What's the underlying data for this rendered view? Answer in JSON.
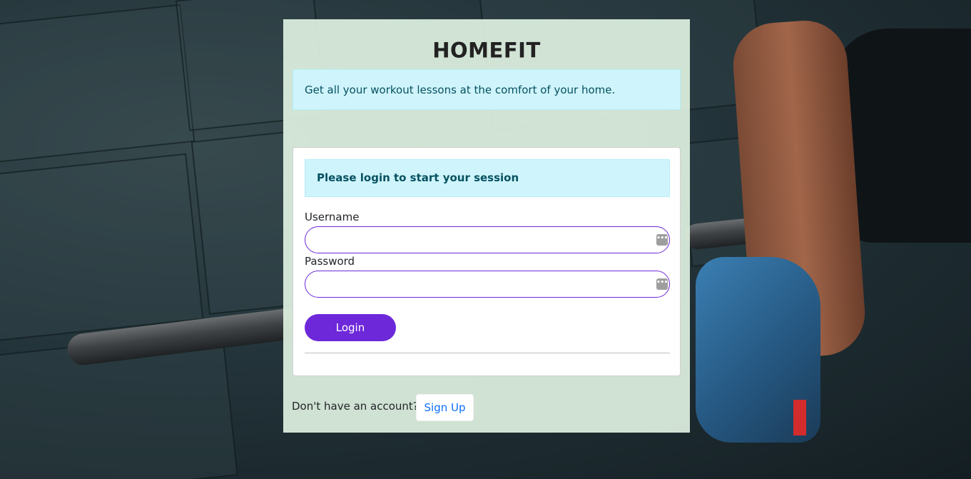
{
  "app": {
    "title": "HOMEFIT",
    "tagline": "Get all your workout lessons at the comfort of your home."
  },
  "login_card": {
    "notice": "Please login to start your session",
    "username_label": "Username",
    "username_value": "",
    "password_label": "Password",
    "password_value": "",
    "login_label": "Login"
  },
  "footer": {
    "prompt": "Don't have an account?",
    "signup_label": "Sign Up"
  },
  "icons": {
    "field_icon": "password-manager-dots-icon"
  },
  "colors": {
    "accent": "#6d28d9",
    "info_bg": "#cff4fc",
    "info_text": "#055160",
    "link": "#0d6efd",
    "panel_bg": "#def0e0"
  }
}
